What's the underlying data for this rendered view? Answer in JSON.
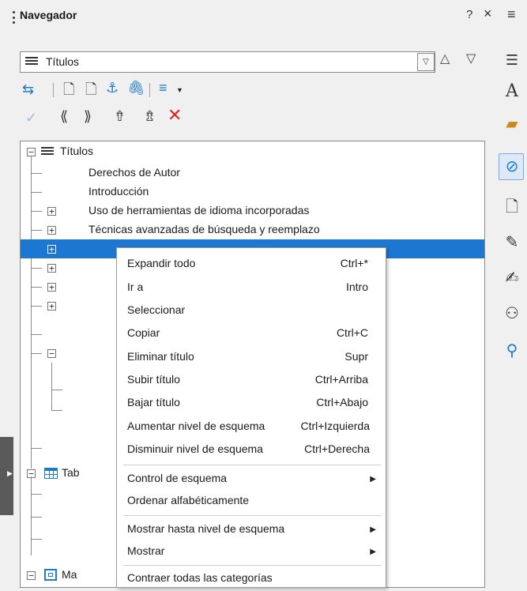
{
  "header": {
    "title": "Navegador",
    "help": "?",
    "close": "×",
    "menu": "≡"
  },
  "content_combo": {
    "selected": "Títulos"
  },
  "tree": {
    "root": "Títulos",
    "headings": [
      "Derechos de Autor",
      "Introducción",
      "Uso de herramientas de idioma incorporadas",
      "Técnicas avanzadas de búsqueda y reemplazo"
    ],
    "tables": "Tab",
    "frames": "Ma"
  },
  "context_menu": {
    "items": [
      {
        "label": "Expandir todo",
        "shortcut": "Ctrl+*"
      },
      {
        "label": "Ir a",
        "shortcut": "Intro"
      },
      {
        "label": "Seleccionar",
        "shortcut": ""
      },
      {
        "label": "Copiar",
        "shortcut": "Ctrl+C"
      },
      {
        "label": "Eliminar título",
        "shortcut": "Supr"
      },
      {
        "label": "Subir título",
        "shortcut": "Ctrl+Arriba"
      },
      {
        "label": "Bajar título",
        "shortcut": "Ctrl+Abajo"
      },
      {
        "label": "Aumentar nivel de esquema",
        "shortcut": "Ctrl+Izquierda"
      },
      {
        "label": "Disminuir nivel de esquema",
        "shortcut": "Ctrl+Derecha"
      },
      {
        "label": "Control de esquema",
        "shortcut": ""
      },
      {
        "label": "Ordenar alfabéticamente",
        "shortcut": ""
      },
      {
        "label": "Mostrar hasta nivel de esquema",
        "shortcut": ""
      },
      {
        "label": "Mostrar",
        "shortcut": ""
      },
      {
        "label": "Contraer todas las categorías",
        "shortcut": ""
      }
    ]
  },
  "colors": {
    "selection": "#1c77d2",
    "accent": "#1f7ac8",
    "delete": "#e02020"
  }
}
